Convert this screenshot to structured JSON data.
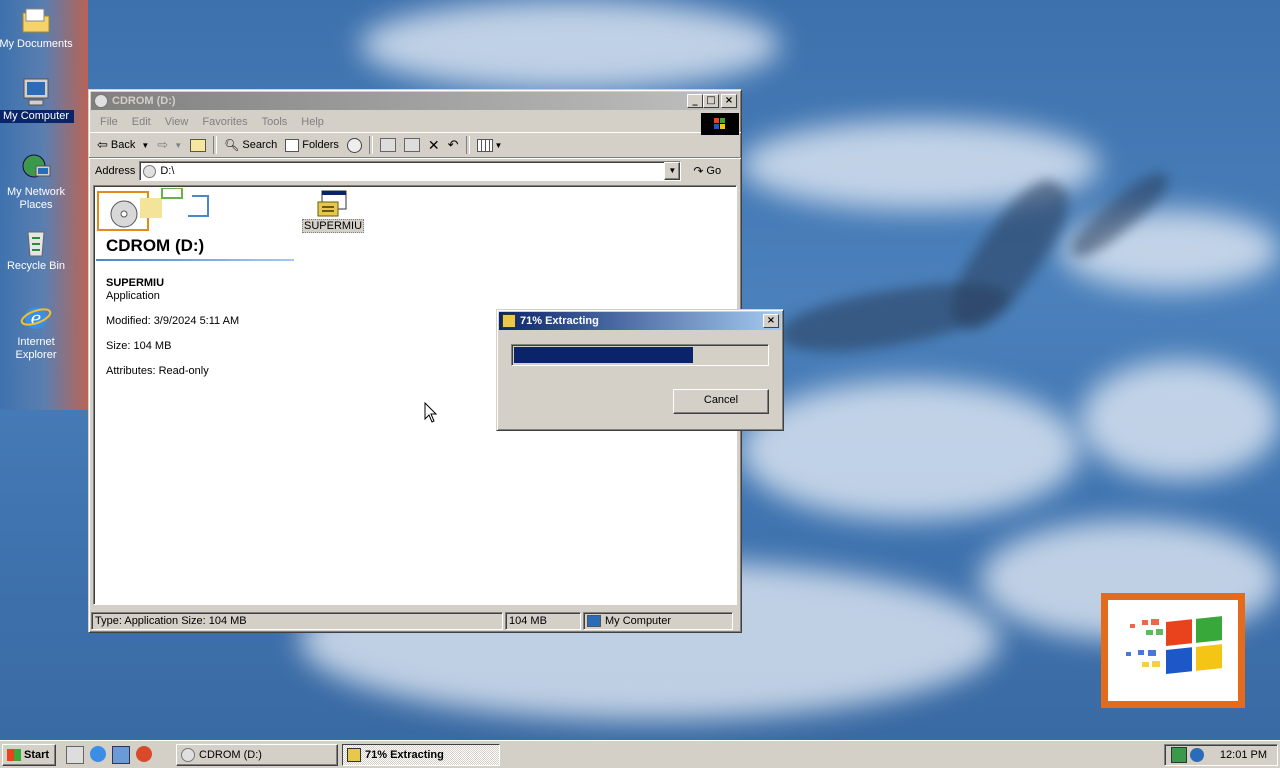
{
  "desktop": {
    "icons": [
      {
        "label": "My Documents",
        "icon": "folder-icon"
      },
      {
        "label": "My Computer",
        "icon": "computer-icon"
      },
      {
        "label": "My Network Places",
        "icon": "network-icon"
      },
      {
        "label": "Recycle Bin",
        "icon": "recycle-bin-icon"
      },
      {
        "label": "Internet Explorer",
        "icon": "ie-icon"
      }
    ]
  },
  "explorer": {
    "title": "CDROM (D:)",
    "menu": [
      "File",
      "Edit",
      "View",
      "Favorites",
      "Tools",
      "Help"
    ],
    "toolbar": {
      "back": "Back",
      "search": "Search",
      "folders": "Folders"
    },
    "address": {
      "label": "Address",
      "value": "D:\\",
      "go": "Go"
    },
    "panel": {
      "heading": "CDROM (D:)",
      "file_name": "SUPERMIU",
      "file_type": "Application",
      "modified": "Modified: 3/9/2024 5:11 AM",
      "size": "Size: 104 MB",
      "attributes": "Attributes: Read-only"
    },
    "file_icon_label": "SUPERMIU",
    "status": {
      "left": "Type: Application Size: 104 MB",
      "size": "104 MB",
      "zone": "My Computer"
    }
  },
  "dialog": {
    "title": "71% Extracting",
    "progress_percent": 71,
    "cancel": "Cancel"
  },
  "taskbar": {
    "start": "Start",
    "tasks": [
      {
        "label": "CDROM (D:)",
        "active": false
      },
      {
        "label": "71% Extracting",
        "active": true
      }
    ],
    "clock": "12:01 PM"
  },
  "colors": {
    "titlebar_active": "#0a246a",
    "progress_fill": "#0a246a",
    "desktop": "#3a6ea5"
  }
}
